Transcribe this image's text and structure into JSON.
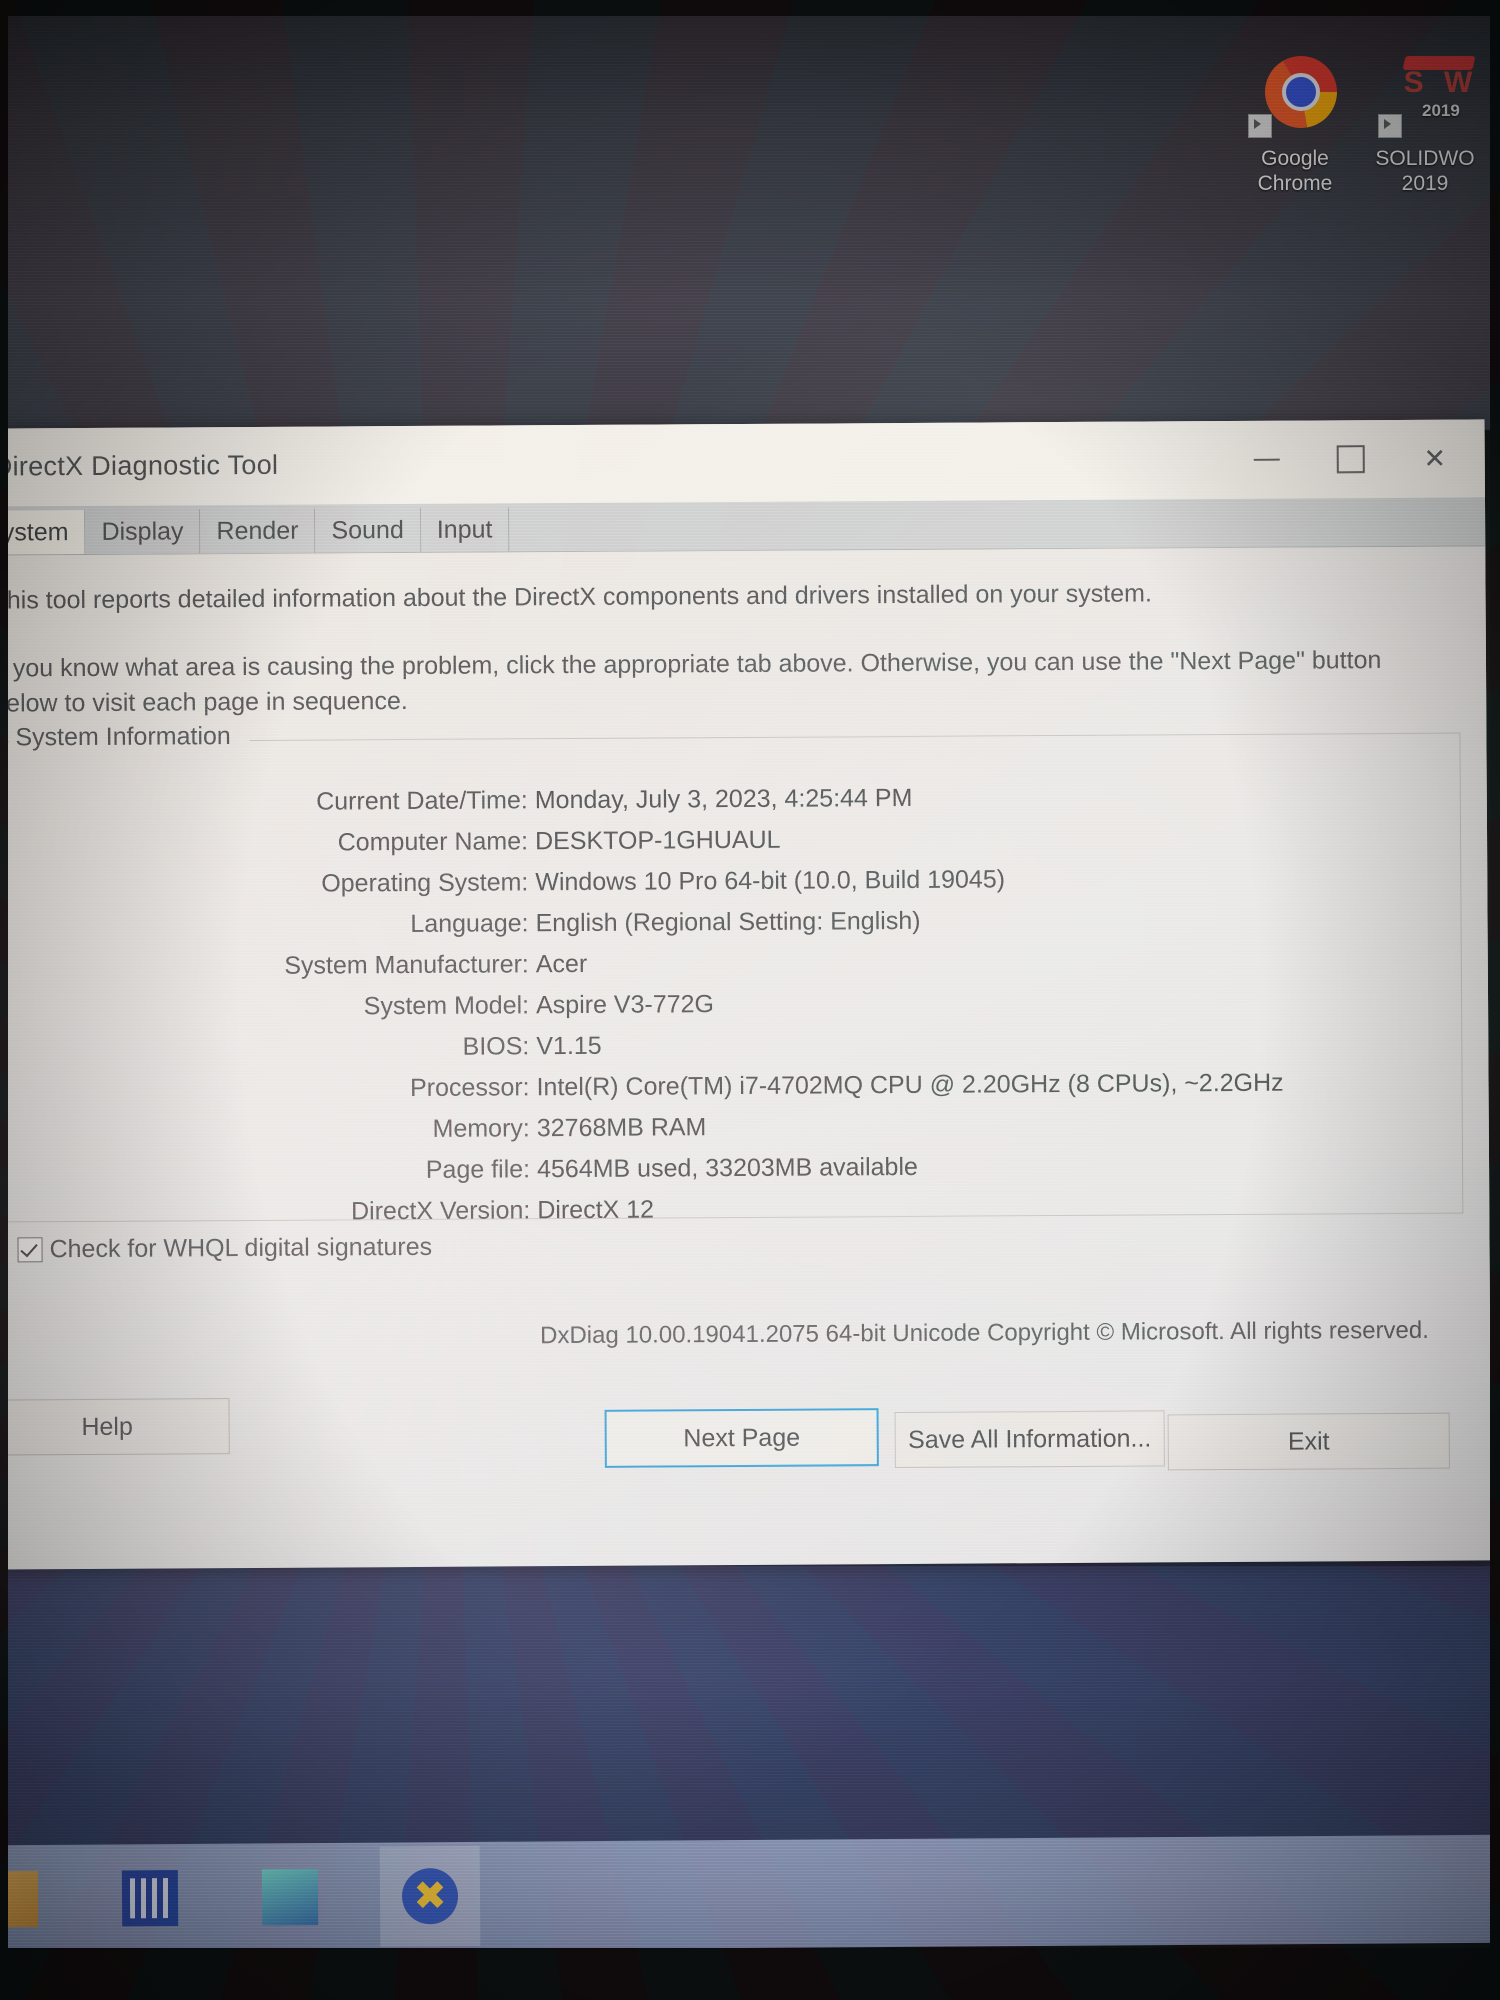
{
  "desktop": {
    "icons": [
      {
        "label_line1": "Google",
        "label_line2": "Chrome",
        "icon": "chrome-icon"
      },
      {
        "label_line1": "SOLIDWO",
        "label_line2": "2019",
        "icon": "solidworks-icon",
        "badge_text": "S W",
        "badge_year": "2019"
      }
    ]
  },
  "window": {
    "title": "DirectX Diagnostic Tool",
    "controls": {
      "minimize": "—",
      "maximize": "☐",
      "close": "✕"
    },
    "tabs": [
      {
        "label": "System",
        "active": true
      },
      {
        "label": "Display",
        "active": false
      },
      {
        "label": "Render",
        "active": false
      },
      {
        "label": "Sound",
        "active": false
      },
      {
        "label": "Input",
        "active": false
      }
    ],
    "intro": {
      "paragraph1": "This tool reports detailed information about the DirectX components and drivers installed on your system.",
      "paragraph2": "If you know what area is causing the problem, click the appropriate tab above.  Otherwise, you can use the \"Next Page\" button below to visit each page in sequence."
    },
    "system_information": {
      "legend": "System Information",
      "rows": [
        {
          "key": "Current Date/Time:",
          "value": "Monday, July 3, 2023, 4:25:44 PM"
        },
        {
          "key": "Computer Name:",
          "value": "DESKTOP-1GHUAUL"
        },
        {
          "key": "Operating System:",
          "value": "Windows 10 Pro 64-bit (10.0, Build 19045)"
        },
        {
          "key": "Language:",
          "value": "English (Regional Setting: English)"
        },
        {
          "key": "System Manufacturer:",
          "value": "Acer"
        },
        {
          "key": "System Model:",
          "value": "Aspire V3-772G"
        },
        {
          "key": "BIOS:",
          "value": "V1.15"
        },
        {
          "key": "Processor:",
          "value": "Intel(R) Core(TM) i7-4702MQ CPU @ 2.20GHz (8 CPUs), ~2.2GHz"
        },
        {
          "key": "Memory:",
          "value": "32768MB RAM"
        },
        {
          "key": "Page file:",
          "value": "4564MB used, 33203MB available"
        },
        {
          "key": "DirectX Version:",
          "value": "DirectX 12"
        }
      ]
    },
    "whql_checkbox": {
      "label": "Check for WHQL digital signatures",
      "checked": true
    },
    "copyright": "DxDiag 10.00.19041.2075 64-bit Unicode  Copyright © Microsoft. All rights reserved.",
    "buttons": {
      "help": "Help",
      "next_page": "Next Page",
      "save_all": "Save All Information...",
      "exit": "Exit"
    }
  },
  "taskbar": {
    "items": [
      {
        "name": "taskbar-item-folder",
        "active": false
      },
      {
        "name": "taskbar-item-calculator",
        "active": false
      },
      {
        "name": "taskbar-item-photos",
        "active": false
      },
      {
        "name": "taskbar-item-dxdiag",
        "active": true
      }
    ]
  },
  "colors": {
    "accent_focus": "#2f9fd6",
    "window_face": "#efeae4",
    "tab_strip": "#cfcfcf",
    "taskbar": "#8793b5",
    "desktop_bottom": "#2e3760"
  }
}
